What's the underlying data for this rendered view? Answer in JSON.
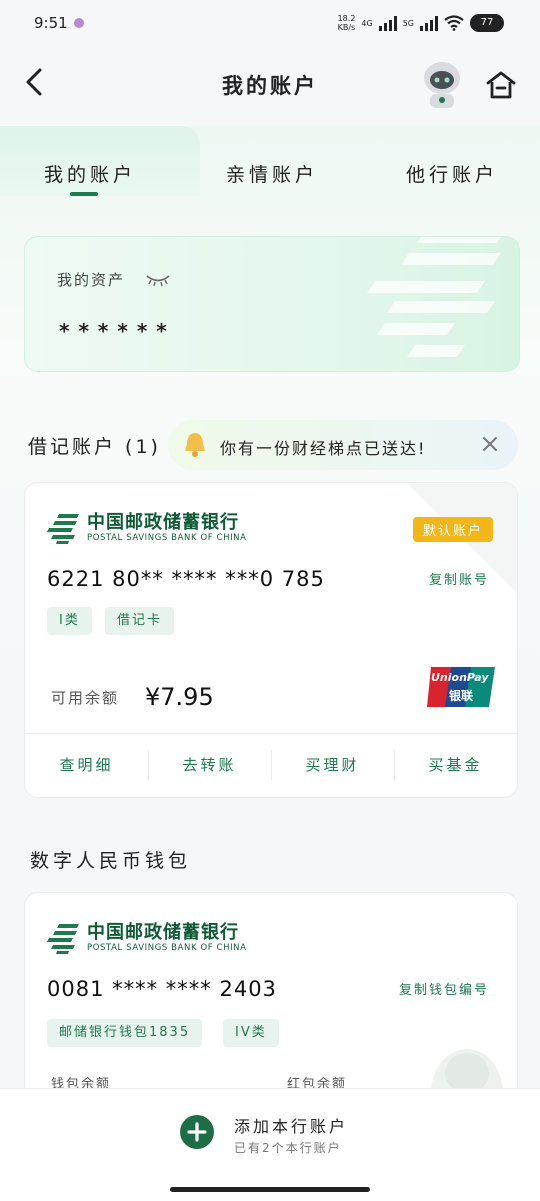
{
  "status": {
    "time": "9:51",
    "net_speed": "18.2\nKB/s",
    "net_type": "4G",
    "net_type2": "5G",
    "battery": "77"
  },
  "header": {
    "title": "我的账户"
  },
  "tabs": [
    {
      "label": "我的账户"
    },
    {
      "label": "亲情账户"
    },
    {
      "label": "他行账户"
    }
  ],
  "assets": {
    "label": "我的资产",
    "value": "******"
  },
  "debit_section": {
    "title": "借记账户 (1)"
  },
  "notice": {
    "text": "你有一份财经梯点已送达!"
  },
  "bank": {
    "name_cn": "中国邮政储蓄银行",
    "name_en": "POSTAL SAVINGS BANK OF CHINA"
  },
  "debit_card": {
    "default_badge": "默认账户",
    "account_no": "6221 80** **** ***0 785",
    "copy_label": "复制账号",
    "tags": [
      "I类",
      "借记卡"
    ],
    "balance_label": "可用余额",
    "balance_value": "¥7.95",
    "unionpay_en": "UnionPay",
    "unionpay_cn": "银联",
    "actions": [
      "查明细",
      "去转账",
      "买理财",
      "买基金"
    ]
  },
  "digital_section": {
    "title": "数字人民币钱包"
  },
  "wallet_card": {
    "account_no": "0081 **** **** 2403",
    "copy_label": "复制钱包编号",
    "tags": [
      "邮储银行钱包1835",
      "IV类"
    ],
    "wallet_balance_label": "钱包余额",
    "red_packet_label": "红包余额"
  },
  "bottom": {
    "add_label": "添加本行账户",
    "add_sub": "已有2个本行账户"
  },
  "colors": {
    "brand_green": "#1d7a4f",
    "badge_yellow": "#f2b617"
  }
}
